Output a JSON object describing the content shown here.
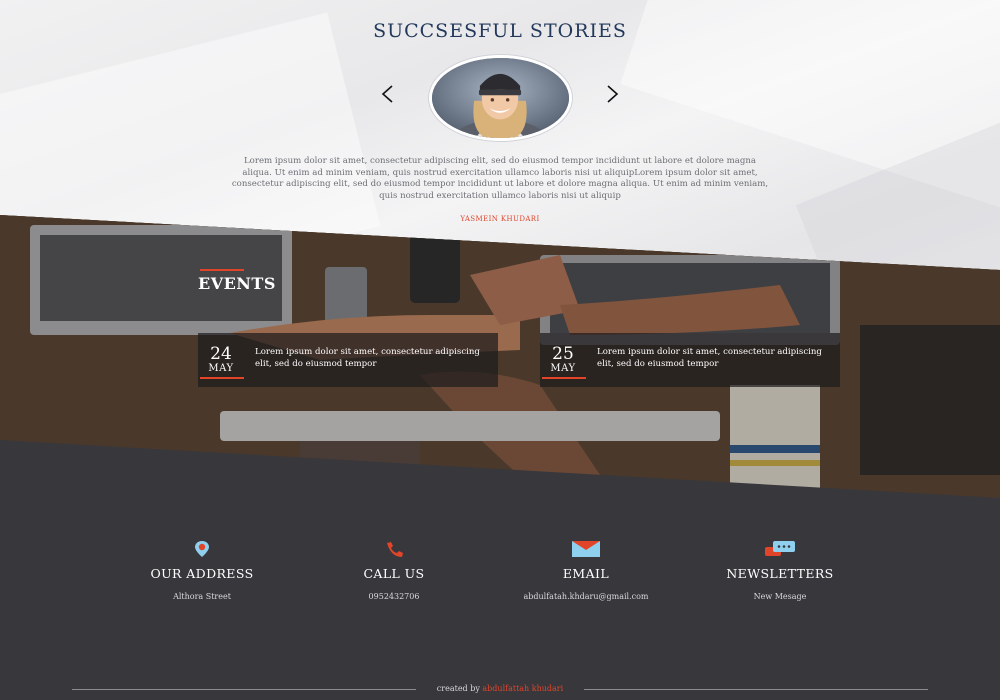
{
  "stories": {
    "title": "SUCCSESFUL STORIES",
    "text": "Lorem ipsum dolor sit amet, consectetur adipiscing elit, sed do eiusmod tempor incididunt ut labore et dolore magna aliqua. Ut enim ad minim veniam, quis nostrud exercitation ullamco laboris nisi ut aliquipLorem ipsum dolor sit amet, consectetur adipiscing elit, sed do eiusmod tempor incididunt ut labore et dolore magna aliqua. Ut enim ad minim veniam, quis nostrud exercitation ullamco laboris nisi ut aliquip",
    "author": "YASMEIN KHUDARI",
    "prev_icon": "chevron-left-icon",
    "next_icon": "chevron-right-icon"
  },
  "events": {
    "title": "EVENTS",
    "items": [
      {
        "day": "24",
        "month": "MAY",
        "text": "Lorem ipsum dolor sit amet, consectetur adipiscing elit, sed do eiusmod tempor"
      },
      {
        "day": "25",
        "month": "MAY",
        "text": "Lorem ipsum dolor sit amet, consectetur adipiscing elit, sed do eiusmod tempor"
      }
    ]
  },
  "contacts": [
    {
      "icon": "location-pin-icon",
      "title": "OUR ADDRESS",
      "value": "Althora Street"
    },
    {
      "icon": "phone-icon",
      "title": "CALL US",
      "value": "0952432706"
    },
    {
      "icon": "envelope-icon",
      "title": "EMAIL",
      "value": "abdulfatah.khdaru@gmail.com"
    },
    {
      "icon": "chat-bubbles-icon",
      "title": "NEWSLETTERS",
      "value": "New Mesage"
    }
  ],
  "footer": {
    "credit_prefix": "created by",
    "credit_author": "abdulfattah khudari"
  },
  "colors": {
    "accent": "#e0452a",
    "title_navy": "#23395b",
    "footer_bg": "#38373c",
    "icon_blue": "#8fd0ee"
  }
}
